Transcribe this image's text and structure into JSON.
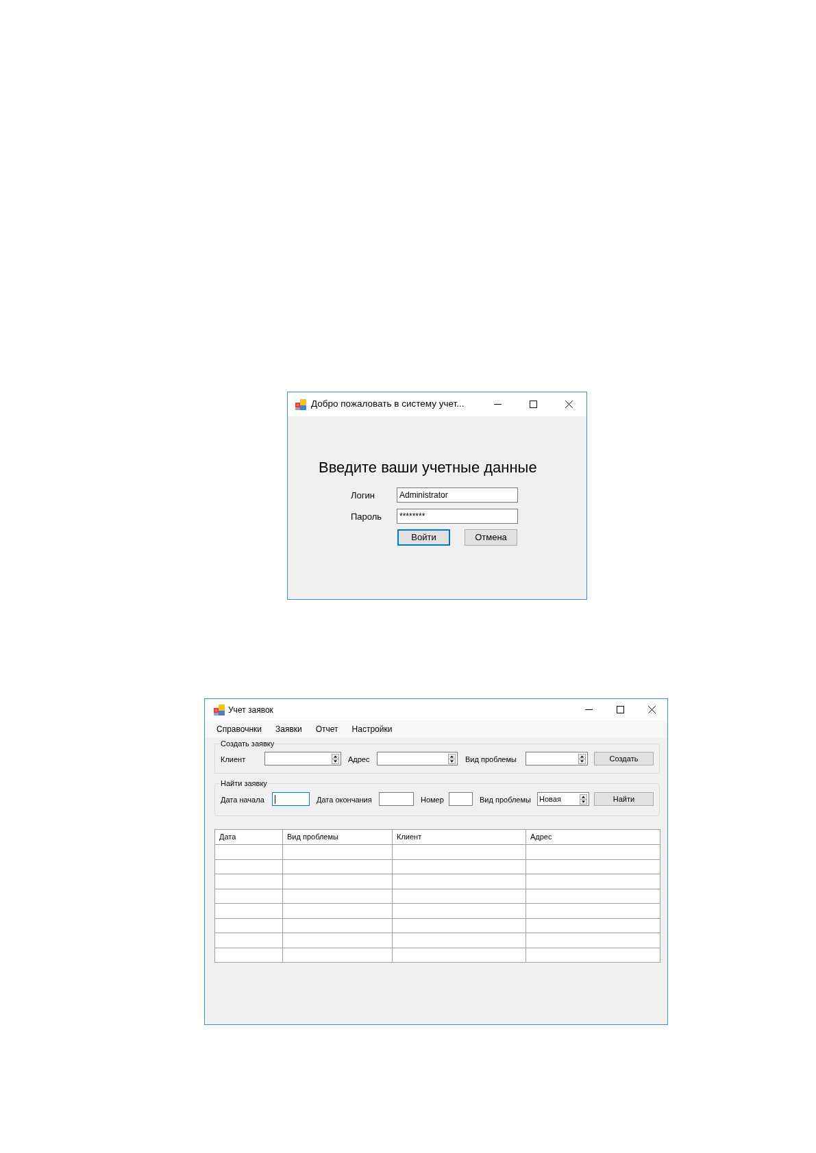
{
  "login_window": {
    "title": "Добро пожаловать в систему учет...",
    "heading": "Введите ваши учетные данные",
    "fields": [
      {
        "label": "Логин",
        "value": "Administrator"
      },
      {
        "label": "Пароль",
        "value": "********"
      }
    ],
    "buttons": [
      {
        "label": "Войти",
        "focused": true
      },
      {
        "label": "Отмена",
        "focused": false
      }
    ]
  },
  "main_window": {
    "title": "Учет заявок",
    "menu": [
      "Справочнки",
      "Заявки",
      "Отчет",
      "Настройки"
    ],
    "create_group": {
      "title": "Создать заявку",
      "fields": [
        {
          "label": "Клиент",
          "kind": "spinner"
        },
        {
          "label": "Адрес",
          "kind": "spinner"
        },
        {
          "label": "Вид проблемы",
          "kind": "spinner"
        }
      ],
      "button": "Создать"
    },
    "find_group": {
      "title": "Найти заявку",
      "fields": [
        {
          "label": "Дата начала",
          "kind": "text",
          "focused": true
        },
        {
          "label": "Дата окончания",
          "kind": "text",
          "focused": false
        },
        {
          "label": "Номер",
          "kind": "text",
          "focused": false
        },
        {
          "label": "Вид проблемы",
          "kind": "spinner",
          "focused": false,
          "value": "Новая"
        }
      ],
      "button": "Найти"
    },
    "table": {
      "columns": [
        "Дата",
        "Вид проблемы",
        "Клиент",
        "Адрес"
      ],
      "rows": [
        {
          "kind": "blank"
        },
        {
          "kind": "blank"
        },
        {
          "kind": "blank"
        },
        {
          "kind": "blank"
        },
        {
          "kind": "blank"
        },
        {
          "kind": "blank"
        },
        {
          "kind": "blank"
        },
        {
          "kind": "blank"
        }
      ]
    }
  }
}
